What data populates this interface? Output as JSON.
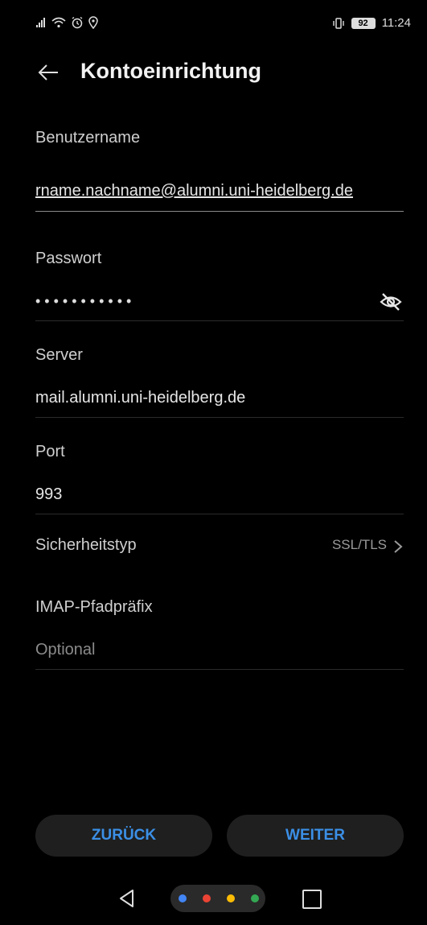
{
  "status_bar": {
    "icons": [
      "signal-icon",
      "wifi-icon",
      "alarm-icon",
      "location-icon",
      "vibrate-icon"
    ],
    "battery": "92",
    "time": "11:24"
  },
  "header": {
    "title": "Kontoeinrichtung",
    "back_icon": "arrow-left-icon"
  },
  "form": {
    "username": {
      "label": "Benutzername",
      "value": "rname.nachname@alumni.uni-heidelberg.de"
    },
    "password": {
      "label": "Passwort",
      "value": "•••••••••••",
      "toggle_icon": "eye-slash-icon"
    },
    "server": {
      "label": "Server",
      "value": "mail.alumni.uni-heidelberg.de"
    },
    "port": {
      "label": "Port",
      "value": "993"
    },
    "security": {
      "label": "Sicherheitstyp",
      "value": "SSL/TLS"
    },
    "imap_prefix": {
      "label": "IMAP-Pfadpräfix",
      "placeholder": "Optional"
    }
  },
  "buttons": {
    "back": "ZURÜCK",
    "next": "WEITER"
  },
  "nav_bar": {
    "icons": [
      "nav-back-icon",
      "home-assistant-icon",
      "recents-icon"
    ],
    "dot_colors": [
      "#4285f4",
      "#ea4335",
      "#fbbc05",
      "#34a853"
    ]
  },
  "colors": {
    "accent": "#3b8fe6",
    "background": "#000000"
  }
}
